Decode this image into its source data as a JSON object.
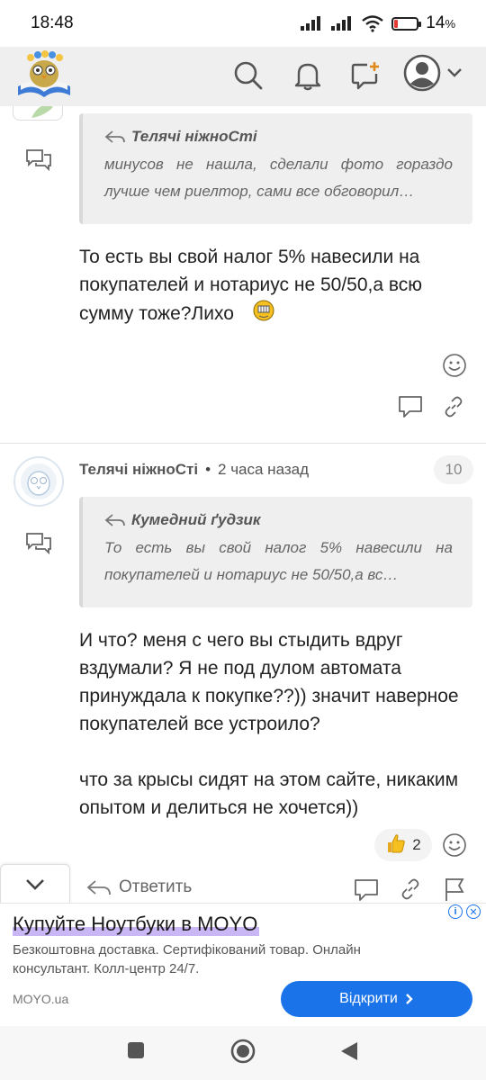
{
  "status": {
    "time": "18:48",
    "battery": "14",
    "battery_unit": "%"
  },
  "header": {
    "icons": [
      "search-icon",
      "bell-icon",
      "new-post-icon",
      "user-avatar-icon",
      "chevron-down-icon"
    ]
  },
  "comment1": {
    "quote_author": "Телячі ніжноСті",
    "quote_text": "минусов не нашла, сделали фото гораздо лучше чем риелтор, сами все обговорил…",
    "message": "То есть вы свой налог 5% навесили на покупателей и нотариус не 50/50,а всю сумму тоже?Лихо"
  },
  "comment2": {
    "author": "Телячі ніжноСті",
    "separator": "•",
    "time": "2 часа назад",
    "rating": "10",
    "quote_author": "Кумедний ґудзик",
    "quote_text": "То есть вы свой налог 5% навесили на покупателей и нотариус не 50/50,а вс…",
    "message_p1": "И что? меня с чего вы стыдить вдруг вздумали? Я не под дулом автомата принуждала к покупке??)) значит наверное покупателей все устроило?",
    "message_p2": "что за крысы сидят на этом сайте, никаким опытом и делиться не хочется))",
    "likes": "2",
    "reply_label": "Ответить"
  },
  "ad": {
    "title": "Купуйте Ноутбуки в MOYO",
    "description": "Безкоштовна доставка. Сертифікований товар. Онлайн консультант. Колл-центр 24/7.",
    "source": "MOYO.ua",
    "cta": "Відкрити",
    "accent": "#1a73e8"
  },
  "colors": {
    "header_bg": "#efefef",
    "quote_bg": "#efefef",
    "battery_low": "#e53935"
  }
}
